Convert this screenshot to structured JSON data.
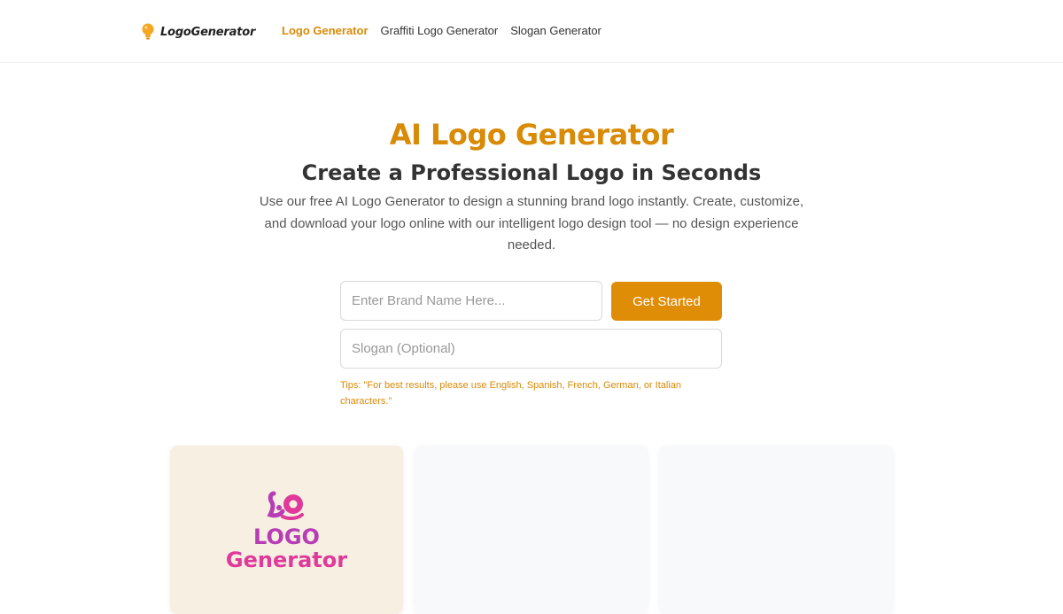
{
  "header": {
    "brand": "LogoGenerator",
    "nav": [
      {
        "label": "Logo Generator",
        "active": true
      },
      {
        "label": "Graffiti Logo Generator",
        "active": false
      },
      {
        "label": "Slogan Generator",
        "active": false
      }
    ]
  },
  "hero": {
    "title": "AI Logo Generator",
    "subtitle": "Create a Professional Logo in Seconds",
    "description": "Use our free AI Logo Generator to design a stunning brand logo instantly. Create, customize, and download your logo online with our intelligent logo design tool — no design experience needed."
  },
  "form": {
    "brand_placeholder": "Enter Brand Name Here...",
    "slogan_placeholder": "Slogan (Optional)",
    "start_label": "Get Started",
    "tips": "Tips: \"For best results, please use English, Spanish, French, German, or Italian characters.\""
  },
  "cards": {
    "sample_logo": {
      "line1": "LOGO",
      "line2": "Generator"
    }
  },
  "colors": {
    "accent": "#df8c06",
    "logo_purple": "#b73db4",
    "logo_pink": "#e0399a"
  },
  "icons": {
    "brand_icon": "lightbulb-icon",
    "card_mark": "logo-mark-icon"
  }
}
